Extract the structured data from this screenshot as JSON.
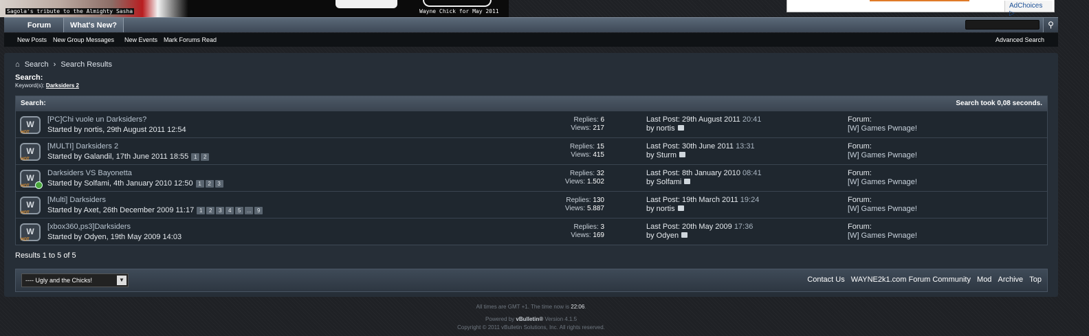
{
  "banner": {
    "caption": "Sagola's tribute to the Almighty Sasha",
    "chick_caption": "Wayne  Chick for May 2011",
    "adchoices": "AdChoices ▷"
  },
  "navbar": {
    "tabs": [
      "Forum",
      "What's New?"
    ],
    "search_icon": "🔍"
  },
  "subnav": {
    "links": [
      "New Posts",
      "New Group Messages",
      "New Events",
      "Mark Forums Read"
    ],
    "advanced_search": "Advanced Search"
  },
  "breadcrumb": {
    "home_icon": "home-icon",
    "items": [
      "Search",
      "Search Results"
    ],
    "separator": "›"
  },
  "search": {
    "label": "Search:",
    "keyword_label": "Keyword(s):",
    "keyword": "Darksiders 2"
  },
  "results": {
    "header_left": "Search:",
    "header_right": "Search took 0,08 seconds.",
    "rows": [
      {
        "title": "[PC]Chi vuole un Darksiders?",
        "started": "Started by nortis, 29th August 2011 12:54",
        "pages": [],
        "replies": "6",
        "views": "217",
        "last_date": "Last Post: 29th August 2011",
        "last_time": "20:41",
        "last_by": "by nortis",
        "forum_label": "Forum:",
        "forum": "[W] Games Pwnage!",
        "is_new": false
      },
      {
        "title": "[MULTI] Darksiders 2",
        "started": "Started by Galandil, 17th June 2011 18:55",
        "pages": [
          "1",
          "2"
        ],
        "replies": "15",
        "views": "415",
        "last_date": "Last Post: 30th June 2011",
        "last_time": "13:31",
        "last_by": "by Sturm",
        "forum_label": "Forum:",
        "forum": "[W] Games Pwnage!",
        "is_new": false
      },
      {
        "title": "Darksiders VS Bayonetta",
        "started": "Started by Solfami, 4th January 2010 12:50",
        "pages": [
          "1",
          "2",
          "3"
        ],
        "replies": "32",
        "views": "1.502",
        "last_date": "Last Post: 8th January 2010",
        "last_time": "08:41",
        "last_by": "by Solfami",
        "forum_label": "Forum:",
        "forum": "[W] Games Pwnage!",
        "is_new": true
      },
      {
        "title": "[Multi] Darksiders",
        "started": "Started by Axet, 26th December 2009 11:17",
        "pages": [
          "1",
          "2",
          "3",
          "4",
          "5",
          "...",
          "9"
        ],
        "replies": "130",
        "views": "5.887",
        "last_date": "Last Post: 19th March 2011",
        "last_time": "19:24",
        "last_by": "by nortis",
        "forum_label": "Forum:",
        "forum": "[W] Games Pwnage!",
        "is_new": false
      },
      {
        "title": "[xbox360,ps3]Darksiders",
        "started": "Started by Odyen, 19th May 2009 14:03",
        "pages": [],
        "replies": "3",
        "views": "169",
        "last_date": "Last Post: 20th May 2009",
        "last_time": "17:36",
        "last_by": "by Odyen",
        "forum_label": "Forum:",
        "forum": "[W] Games Pwnage!",
        "is_new": false
      }
    ],
    "replies_label": "Replies:",
    "views_label": "Views:",
    "icon_letter": "W",
    "hot_label": "HOT"
  },
  "results_count": "Results 1 to 5 of 5",
  "footer": {
    "style_select": "---- Ugly and the Chicks!",
    "links": [
      "Contact Us",
      "WAYNE2k1.com Forum Community",
      "Mod",
      "Archive",
      "Top"
    ]
  },
  "copyright": {
    "timezone_prefix": "All times are GMT +1. The time now is",
    "time_now": "22:06",
    "powered_prefix": "Powered by",
    "powered_name": "vBulletin®",
    "powered_version": "Version 4.1.5",
    "line3": "Copyright © 2011 vBulletin Solutions, Inc. All rights reserved."
  },
  "colors": {
    "page_bg": "#1f2125",
    "panel_bg": "#262e37",
    "row_bg": "#1f272f",
    "accent_hot": "#e0902e",
    "new_badge": "#4aa53b"
  }
}
